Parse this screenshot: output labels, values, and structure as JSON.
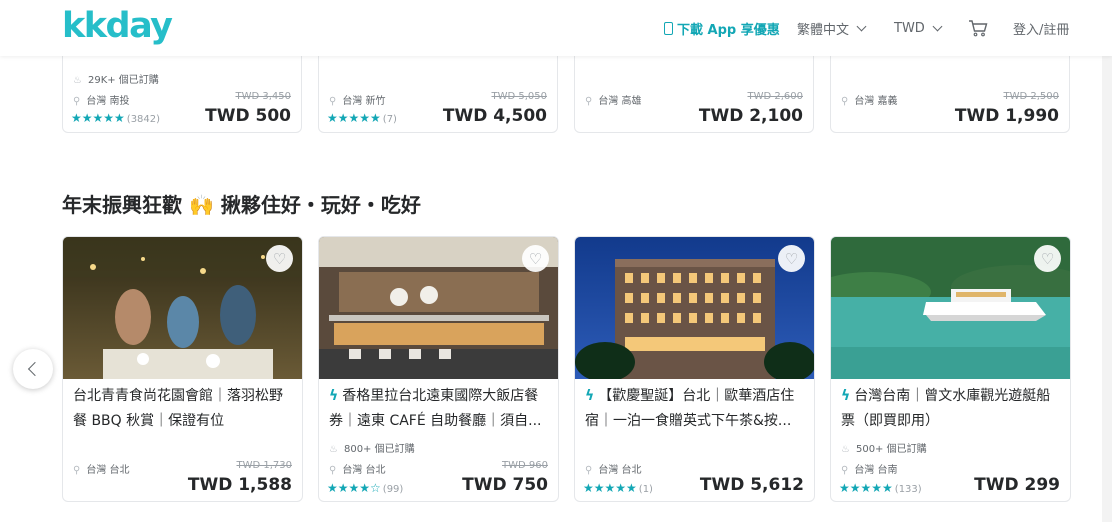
{
  "header": {
    "logo": "kkday",
    "app_promo": "下載 App 享優惠",
    "language": "繁體中文",
    "currency": "TWD",
    "login": "登入/註冊"
  },
  "top_row": [
    {
      "subtitle": "29K+ 個已訂購",
      "location": "台灣 南投",
      "old_price": "TWD 3,450",
      "price": "TWD 500",
      "stars": "★★★★★",
      "reviews": "(3842)"
    },
    {
      "subtitle": "",
      "location": "台灣 新竹",
      "old_price": "TWD 5,050",
      "price": "TWD 4,500",
      "stars": "★★★★★",
      "reviews": "(7)"
    },
    {
      "subtitle": "",
      "location": "台灣 高雄",
      "old_price": "TWD 2,600",
      "price": "TWD 2,100",
      "stars": "",
      "reviews": ""
    },
    {
      "subtitle": "",
      "location": "台灣 嘉義",
      "old_price": "TWD 2,500",
      "price": "TWD 1,990",
      "stars": "",
      "reviews": ""
    }
  ],
  "section": {
    "title": "年末振興狂歡 🙌 揪夥住好・玩好・吃好"
  },
  "cards": [
    {
      "title": "台北青青食尚花園會館｜落羽松野餐 BBQ 秋賞｜保證有位",
      "instant": false,
      "sold": "",
      "location": "台灣 台北",
      "old_price": "TWD 1,730",
      "price": "TWD 1,588",
      "stars": "",
      "reviews": ""
    },
    {
      "title": "香格里拉台北遠東國際大飯店餐券｜遠東 CAFÉ 自助餐廳｜須自...",
      "instant": true,
      "sold": "800+ 個已訂購",
      "location": "台灣 台北",
      "old_price": "TWD 960",
      "price": "TWD 750",
      "stars": "★★★★☆",
      "reviews": "(99)"
    },
    {
      "title": "【歡慶聖誕】台北｜歐華酒店住宿｜一泊一食贈英式下午茶&按...",
      "instant": true,
      "sold": "",
      "location": "台灣 台北",
      "old_price": "",
      "price": "TWD 5,612",
      "stars": "★★★★★",
      "reviews": "(1)"
    },
    {
      "title": "台灣台南｜曾文水庫觀光遊艇船票（即買即用）",
      "instant": true,
      "sold": "500+ 個已訂購",
      "location": "台灣 台南",
      "old_price": "",
      "price": "TWD 299",
      "stars": "★★★★★",
      "reviews": "(133)"
    }
  ],
  "colors": {
    "brand": "#26bec9",
    "accent": "#13a7b5",
    "text": "#26282a"
  }
}
